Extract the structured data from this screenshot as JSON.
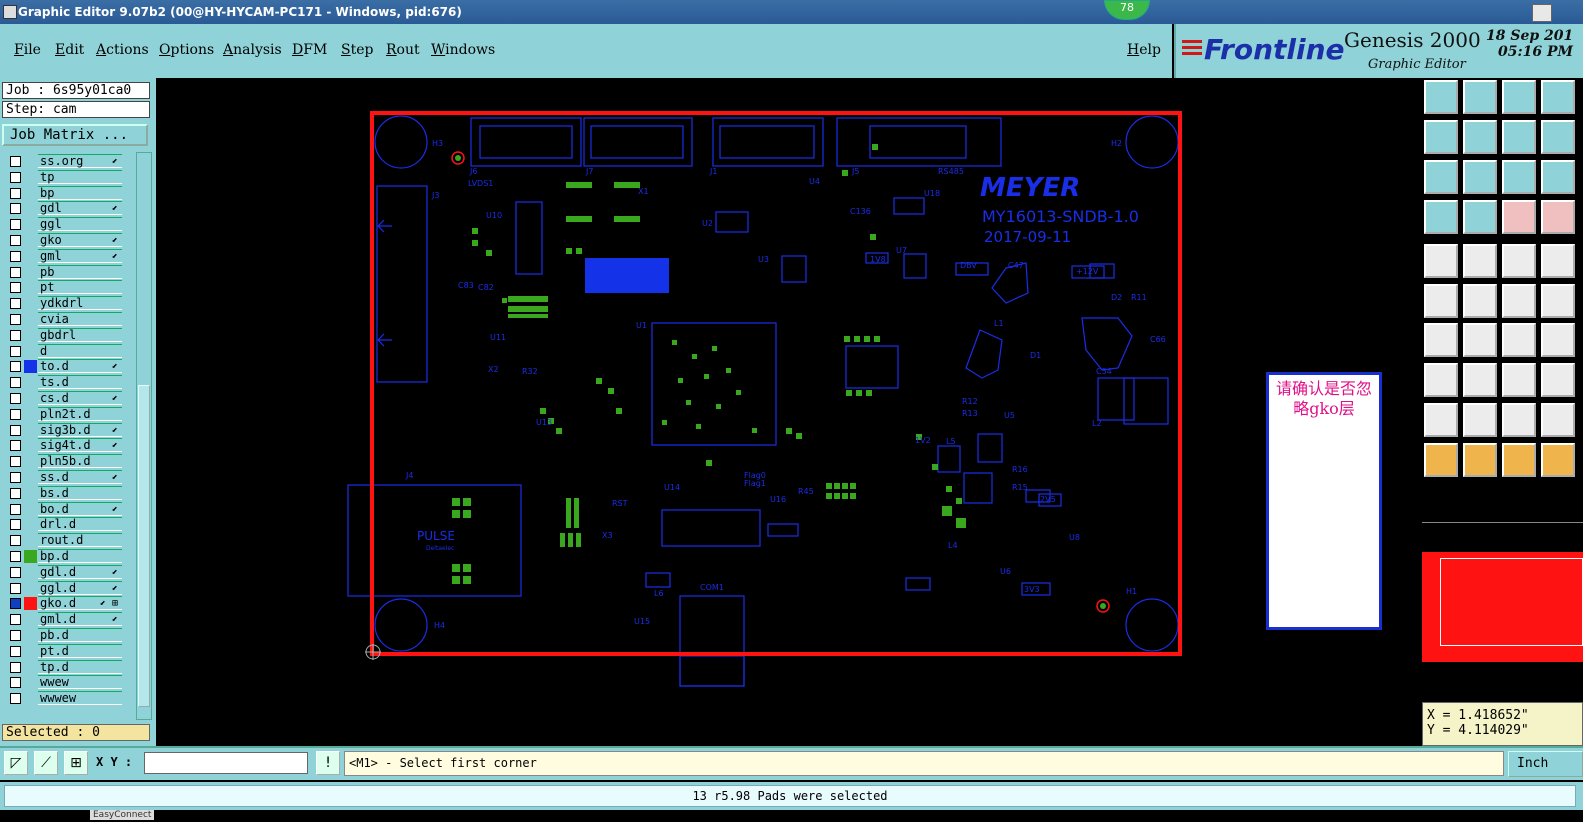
{
  "window": {
    "title": "Graphic Editor 9.07b2 (00@HY-HYCAM-PC171 - Windows, pid:676)",
    "badge": "78"
  },
  "menu": [
    "File",
    "Edit",
    "Actions",
    "Options",
    "Analysis",
    "DFM",
    "Step",
    "Rout",
    "Windows"
  ],
  "help_label": "Help",
  "brand": {
    "logo": "Frontline",
    "product": "Genesis 2000",
    "subtitle": "Graphic Editor",
    "date": "18 Sep 201",
    "time": "05:16 PM"
  },
  "job": {
    "job_label": "Job : 6s95y01ca0",
    "step_label": "Step: cam",
    "matrix_button": "Job Matrix ..."
  },
  "layers": [
    {
      "name": "ss.org",
      "mark": "⬋"
    },
    {
      "name": "tp",
      "mark": ""
    },
    {
      "name": "bp",
      "mark": ""
    },
    {
      "name": "gdl",
      "mark": "⬋"
    },
    {
      "name": "ggl",
      "mark": ""
    },
    {
      "name": "gko",
      "mark": "⬋"
    },
    {
      "name": "gml",
      "mark": "⬋"
    },
    {
      "name": "pb",
      "mark": ""
    },
    {
      "name": "pt",
      "mark": ""
    },
    {
      "name": "ydkdrl",
      "mark": ""
    },
    {
      "name": "cvia",
      "mark": ""
    },
    {
      "name": "gbdrl",
      "mark": ""
    },
    {
      "name": "d",
      "mark": ""
    },
    {
      "name": "to.d",
      "mark": "⬋"
    },
    {
      "name": "ts.d",
      "mark": ""
    },
    {
      "name": "cs.d",
      "mark": "⬋"
    },
    {
      "name": "pln2t.d",
      "mark": ""
    },
    {
      "name": "sig3b.d",
      "mark": "⬋"
    },
    {
      "name": "sig4t.d",
      "mark": "⬋"
    },
    {
      "name": "pln5b.d",
      "mark": ""
    },
    {
      "name": "ss.d",
      "mark": "⬋"
    },
    {
      "name": "bs.d",
      "mark": ""
    },
    {
      "name": "bo.d",
      "mark": "⬋"
    },
    {
      "name": "drl.d",
      "mark": ""
    },
    {
      "name": "rout.d",
      "mark": ""
    },
    {
      "name": "bp.d",
      "mark": ""
    },
    {
      "name": "gdl.d",
      "mark": "⬋"
    },
    {
      "name": "ggl.d",
      "mark": "⬋"
    },
    {
      "name": "gko.d",
      "mark": "⬋ ⊞"
    },
    {
      "name": "gml.d",
      "mark": "⬋"
    },
    {
      "name": "pb.d",
      "mark": ""
    },
    {
      "name": "pt.d",
      "mark": ""
    },
    {
      "name": "tp.d",
      "mark": ""
    },
    {
      "name": "wwew",
      "mark": ""
    },
    {
      "name": "wwwew",
      "mark": ""
    }
  ],
  "selected_label": "Selected : 0",
  "board": {
    "brand_text": "MEYER",
    "part_number": "MY16013-SNDB-1.0",
    "date_code": "2017-09-11",
    "jack_label": "PULSE",
    "jack_sub": "Deltaelec",
    "refs": [
      "H3",
      "H2",
      "H4",
      "H1",
      "J3",
      "J4",
      "J6",
      "J7",
      "J1",
      "J5",
      "U1",
      "U2",
      "U3",
      "U4",
      "U5",
      "U6",
      "U7",
      "U8",
      "U10",
      "U11",
      "U13",
      "U14",
      "U15",
      "U16",
      "U18",
      "X1",
      "X2",
      "X3",
      "L1",
      "L2",
      "L4",
      "L5",
      "L6",
      "D1",
      "D2",
      "RST",
      "COM1",
      "RS485",
      "LVDS1",
      "1V8",
      "DBV",
      "1V2",
      "3V3",
      "2V5",
      "+12V",
      "C47",
      "C54",
      "C66",
      "R11",
      "R12",
      "R13",
      "R15",
      "R16",
      "R32",
      "R45",
      "C136",
      "C83",
      "C82",
      "Flag0",
      "Flag1"
    ]
  },
  "dialog_text": "请确认是否忽略gko层",
  "coords": {
    "x": "X = 1.418652\"",
    "y": "Y = 4.114029\""
  },
  "xy_label": "X Y :",
  "prompt": "<M1> - Select first corner",
  "unit": "Inch",
  "status": "13 r5.98 Pads were selected",
  "easy_connect": "EasyConnect"
}
